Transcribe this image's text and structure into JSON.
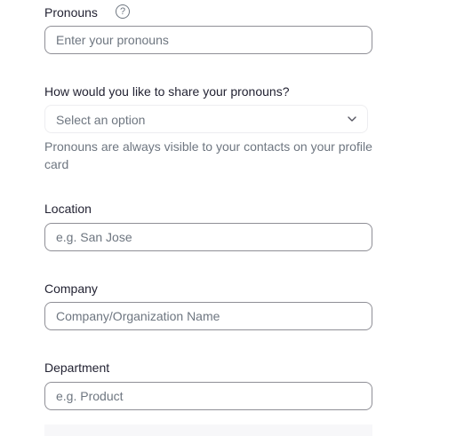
{
  "pronouns": {
    "label": "Pronouns",
    "help_icon": "question-circle-icon",
    "placeholder": "Enter your pronouns",
    "value": ""
  },
  "share_pronouns": {
    "label": "How would you like to share your pronouns?",
    "selected": "Select an option",
    "chevron_icon": "chevron-down-icon",
    "hint": "Pronouns are always visible to your contacts on your profile card"
  },
  "location": {
    "label": "Location",
    "placeholder": "e.g. San Jose",
    "value": ""
  },
  "company": {
    "label": "Company",
    "placeholder": "Company/Organization Name",
    "value": ""
  },
  "department": {
    "label": "Department",
    "placeholder": "e.g. Product",
    "value": ""
  }
}
